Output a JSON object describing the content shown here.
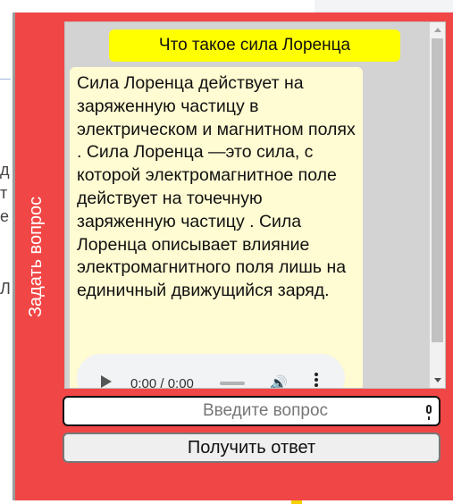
{
  "background": {
    "chars": [
      "д",
      "т",
      "е",
      "Лс"
    ]
  },
  "widget": {
    "side_tab_label": "Задать вопрос",
    "question": "Что такое сила Лоренца",
    "answer": "Сила Лоренца действует на заряженную частицу в электрическом и магнитном полях . Сила Лоренца —это сила, с которой электромагнитное поле действует на точечную заряженную частицу . Сила Лоренца описывает влияние электромагнитного поля лишь на единичный движущийся заряд.",
    "audio": {
      "time": "0:00 / 0:00"
    },
    "input": {
      "value": "",
      "placeholder": "Введите вопрос"
    },
    "submit_label": "Получить ответ"
  },
  "colors": {
    "widget_bg": "#f14646",
    "question_bg": "#ffff00",
    "answer_bg": "#fffbd2"
  }
}
